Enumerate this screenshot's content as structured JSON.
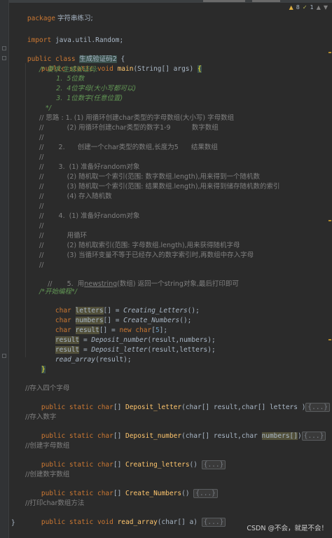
{
  "inspections": {
    "warnings": "8",
    "warn_icon": "warning-icon",
    "weak": "1",
    "up": "▲",
    "down": "▼"
  },
  "colors": {
    "background": "#2b2b2b",
    "keyword": "#cc7832",
    "comment": "#808080",
    "javadoc": "#629755",
    "method": "#ffc66d",
    "number": "#6897bb",
    "text": "#a9b7c6"
  },
  "code": {
    "l_package": {
      "kw": "package",
      "rest": " 字符串练习;"
    },
    "l_import": {
      "kw": "import",
      "rest": " java.util.Random;"
    },
    "l_class": {
      "kw1": "public",
      "kw2": " class ",
      "name": "生成验证码2",
      "rest": " {"
    },
    "l_main": {
      "kw": "public static void ",
      "fn": "main",
      "rest": "(String[] args) ",
      "brace": "{"
    },
    "doc": [
      "/* 要求:生成验证码:",
      "        1.  5位数",
      "        2.  4位字母(大小写都可以)",
      "        3.  1位数字(任意位置)",
      "",
      "   */"
    ],
    "thoughts": [
      "// 思路 : 1. (1) 用循环创建char类型的字母数组(大小写) 字母数组",
      "//           (2) 用循环创建char类型的数字1-9          数字数组",
      "//",
      "//       2.      创建一个char类型的数组,长度为5      结果数组",
      "//",
      "//       3.  (1) 准备好random对象",
      "//           (2) 随机取一个索引(范围: 数字数组.length),用来得到一个随机数",
      "//           (3) 随机取一个索引(范围: 结果数组.length),用来得到储存随机数的索引",
      "//           (4) 存入随机数",
      "//",
      "//       4.  (1) 准备好random对象",
      "//",
      "//           用循环",
      "//           (2) 随机取索引(范围: 字母数组.length),用来获得随机字母",
      "//           (3) 当循环变量不等于已经存入的数字索引时,再数组中存入字母",
      "//"
    ],
    "t5": {
      "pre": "//       5.  用",
      "link": "newstring",
      "post": "(数组) 返回一个string对象,最后打印即可"
    },
    "start_comment": "/*开始编程*/",
    "s1": {
      "kw": "char ",
      "var": "letters",
      "mid": "[] = ",
      "call": "Creating_Letters",
      "end": "();"
    },
    "s2": {
      "kw": "char ",
      "var": "numbers",
      "mid": "[] = ",
      "call": "Create_Numbers",
      "end": "();"
    },
    "s3": {
      "kw": "char ",
      "var": "result",
      "mid": "[] = ",
      "kw2": "new char",
      "lb": "[",
      "num": "5",
      "end": "];"
    },
    "s4": {
      "var": "result",
      "mid": " = ",
      "call": "Deposit_number",
      "args": "(result,numbers);"
    },
    "s5": {
      "var": "result",
      "mid": " = ",
      "call": "Deposit_letter",
      "args": "(result,letters);"
    },
    "s6": {
      "call": "read_array",
      "args": "(result);"
    },
    "close_main": "}",
    "c_letter": "//存入四个字母",
    "m_letter": {
      "kw": "public static ",
      "kw2": "char",
      "mid": "[] ",
      "fn": "Deposit_letter",
      "args": "(char[] result,char[] letters )",
      "fold": "{...}"
    },
    "c_number": "//存入数字",
    "m_number": {
      "kw": "public static ",
      "kw2": "char",
      "mid": "[] ",
      "fn": "Deposit_number",
      "args1": "(char[] result,char ",
      "arg2": "numbers[]",
      "args3": ")",
      "fold": "{...}"
    },
    "c_create_letters": "//创建字母数组",
    "m_create_letters": {
      "kw": "public static ",
      "kw2": "char",
      "mid": "[] ",
      "fn": "Creating_letters",
      "args": "() ",
      "fold": "{...}"
    },
    "c_create_numbers": "//创建数字数组",
    "m_create_numbers": {
      "kw": "public static ",
      "kw2": "char",
      "mid": "[] ",
      "fn": "Create_Numbers",
      "args": "() ",
      "fold": "{...}"
    },
    "c_read": "//打印char数组方法",
    "m_read": {
      "kw": "public static void ",
      "fn": "read_array",
      "args": "(char[] a) ",
      "fold": "{...}"
    },
    "close_class": "}"
  },
  "watermark": "CSDN @不会，就是不会！"
}
